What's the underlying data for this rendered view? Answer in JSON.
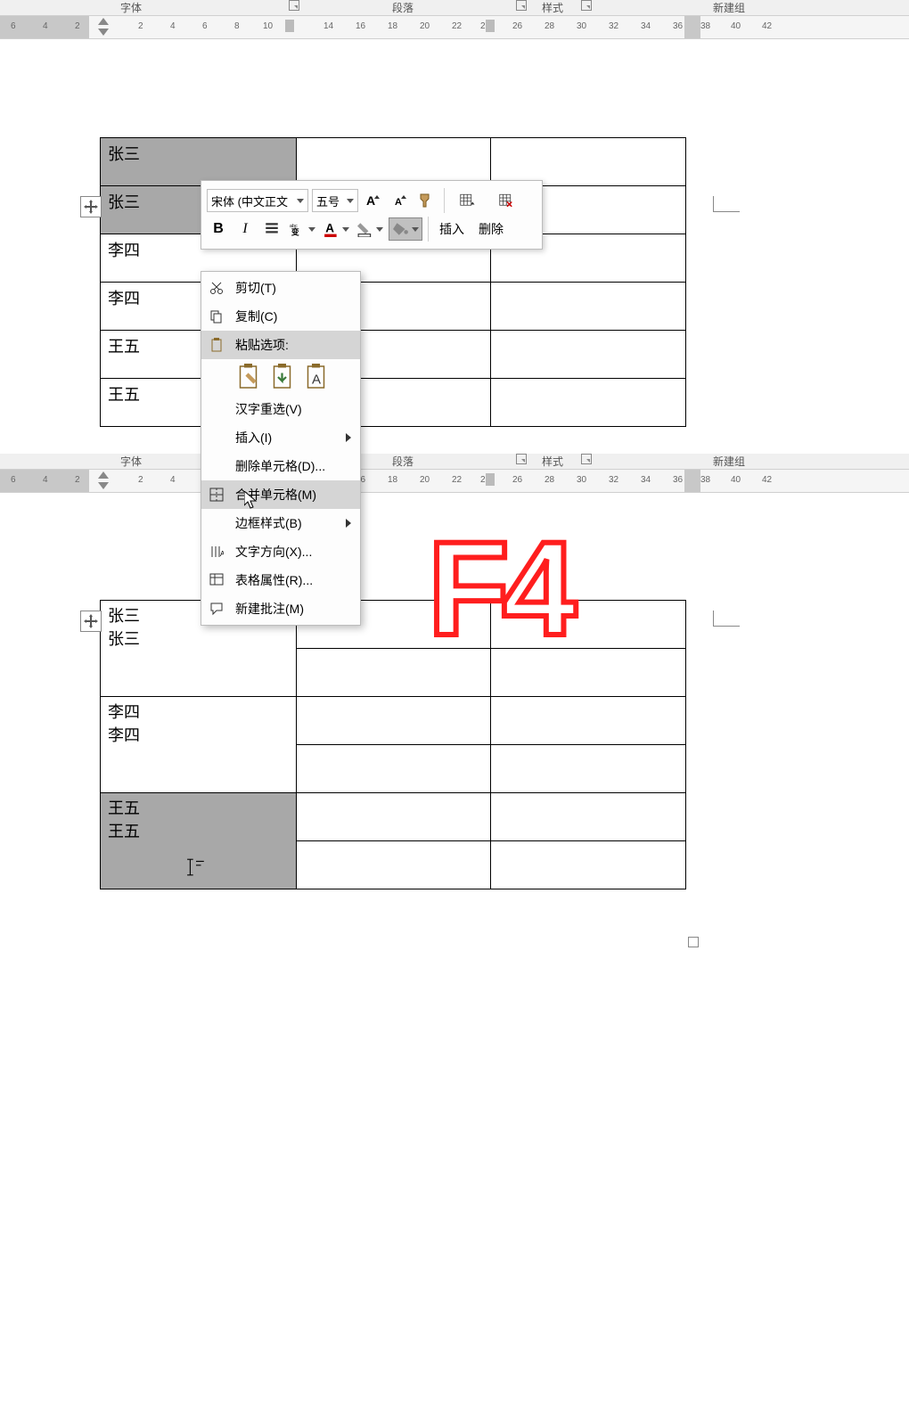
{
  "ribbon": {
    "font_group": "字体",
    "paragraph_group": "段落",
    "styles_group": "样式",
    "new_group": "新建组"
  },
  "ruler": {
    "marks_left": [
      "6",
      "4",
      "2"
    ],
    "marks_right": [
      "2",
      "4",
      "6",
      "8",
      "10",
      "14",
      "16",
      "18",
      "20",
      "22",
      "2",
      "26",
      "28",
      "30",
      "32",
      "34",
      "36",
      "38",
      "40",
      "42"
    ]
  },
  "mini_toolbar": {
    "font_name": "宋体 (中文正文",
    "font_size": "五号",
    "insert_label": "插入",
    "delete_label": "删除"
  },
  "context_menu": {
    "cut": "剪切(T)",
    "copy": "复制(C)",
    "paste_options_label": "粘贴选项:",
    "hanzi_reselect": "汉字重选(V)",
    "insert": "插入(I)",
    "delete_cells": "删除单元格(D)...",
    "merge_cells": "合并单元格(M)",
    "border_styles": "边框样式(B)",
    "text_direction": "文字方向(X)...",
    "table_properties": "表格属性(R)...",
    "new_comment": "新建批注(M)"
  },
  "table1": {
    "rows": [
      {
        "c1": "张三"
      },
      {
        "c1": "张三"
      },
      {
        "c1": "李四"
      },
      {
        "c1": "李四"
      },
      {
        "c1": "王五"
      },
      {
        "c1": "王五"
      }
    ]
  },
  "table2": {
    "rows": [
      {
        "c1a": "张三",
        "c1b": "张三"
      },
      {
        "c1a": "李四",
        "c1b": "李四"
      },
      {
        "c1a": "王五",
        "c1b": "王五"
      }
    ]
  },
  "overlay": {
    "f4": "F4"
  }
}
